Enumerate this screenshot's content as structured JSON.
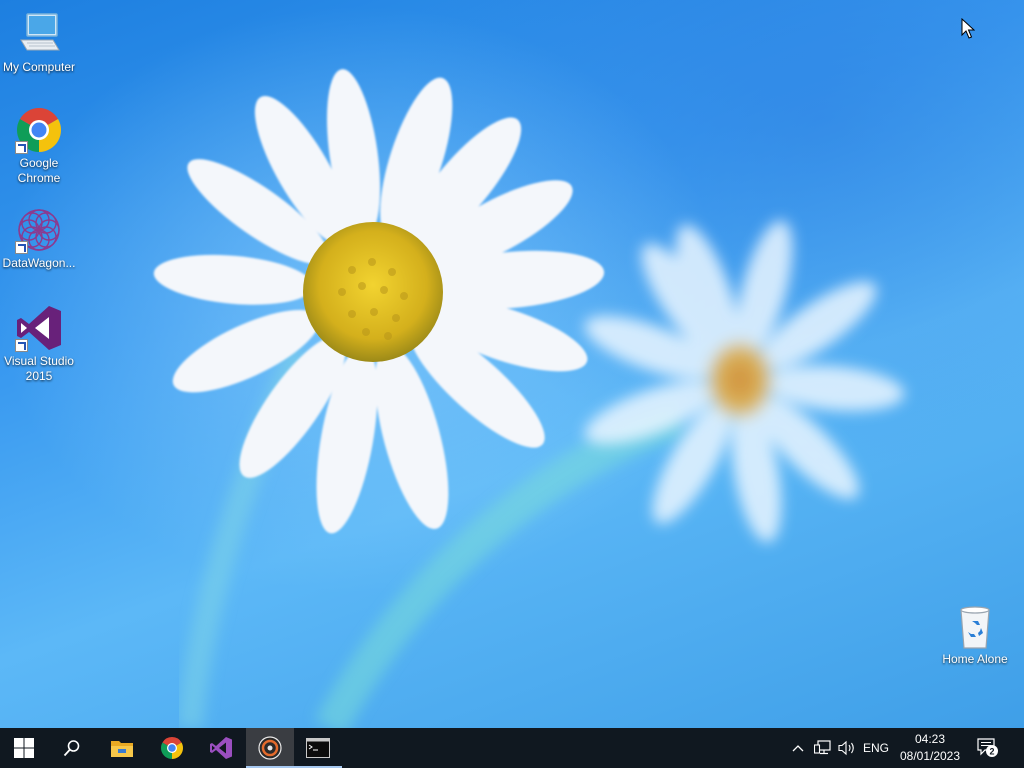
{
  "desktop": {
    "icons": [
      {
        "label": "My Computer",
        "icon": "computer-icon",
        "shortcut": false
      },
      {
        "label": "Google Chrome",
        "icon": "chrome-icon",
        "shortcut": true
      },
      {
        "label": "DataWagon...",
        "icon": "datawagon-icon",
        "shortcut": true
      },
      {
        "label": "Visual Studio 2015",
        "icon": "visual-studio-icon",
        "shortcut": true
      },
      {
        "label": "Home Alone",
        "icon": "recycle-bin-icon",
        "shortcut": false
      }
    ]
  },
  "taskbar": {
    "pinned": [
      {
        "name": "start-button",
        "icon": "windows-logo-icon"
      },
      {
        "name": "search-button",
        "icon": "search-icon"
      },
      {
        "name": "file-explorer",
        "icon": "folder-icon"
      },
      {
        "name": "google-chrome",
        "icon": "chrome-icon"
      },
      {
        "name": "visual-studio",
        "icon": "visual-studio-icon"
      },
      {
        "name": "media-app",
        "icon": "disc-icon",
        "active": true
      },
      {
        "name": "command-prompt",
        "icon": "terminal-icon",
        "running": true
      }
    ],
    "tray": {
      "show_hidden_icon": "chevron-up-icon",
      "network_icon": "network-icon",
      "volume_icon": "volume-icon",
      "language": "ENG",
      "time": "04:23",
      "date": "08/01/2023",
      "notification_count": "2"
    }
  },
  "colors": {
    "taskbar": "#101820",
    "desktop_blue": "#3a9af0",
    "vs_purple": "#68217a"
  }
}
